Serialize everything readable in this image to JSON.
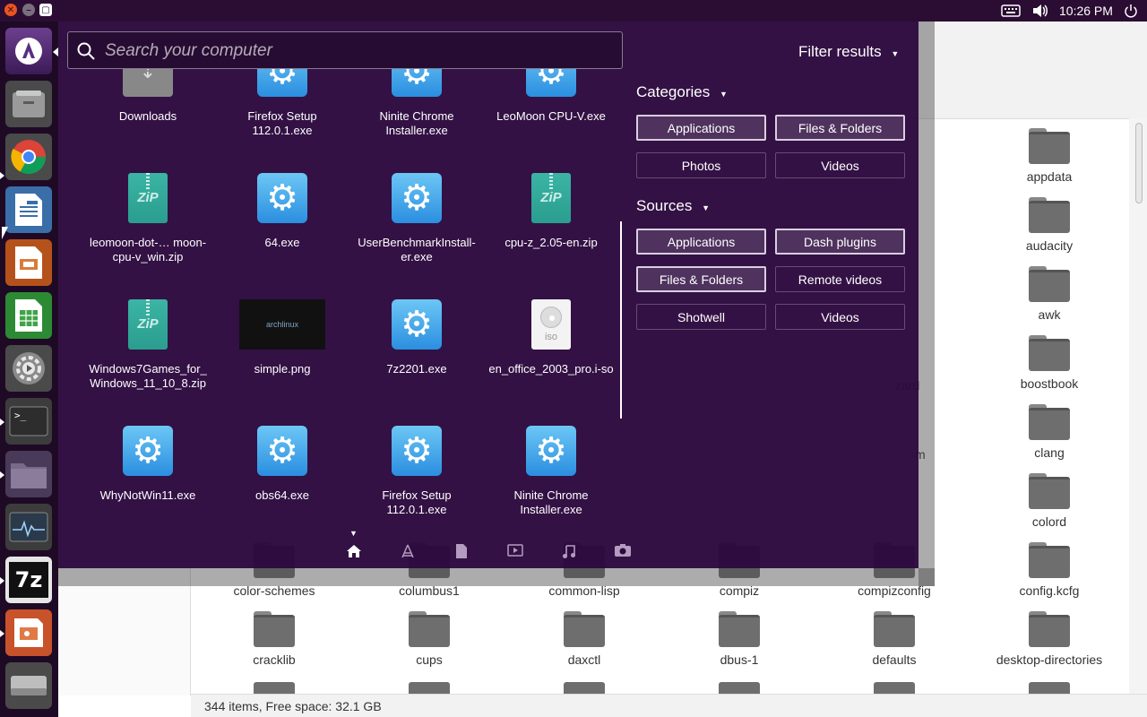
{
  "topbar": {
    "keyboard_icon": "keyboard-icon",
    "volume_icon": "volume-icon",
    "time": "10:26 PM",
    "power_icon": "power-icon"
  },
  "launcher": {
    "items": [
      {
        "name": "dash-home-button",
        "icon": "ubuntu-dash-icon"
      },
      {
        "name": "files-button",
        "icon": "files-icon"
      },
      {
        "name": "chrome-button",
        "icon": "chrome-icon"
      },
      {
        "name": "writer-button",
        "icon": "libreoffice-writer-icon"
      },
      {
        "name": "impress-button",
        "icon": "libreoffice-impress-icon"
      },
      {
        "name": "calc-button",
        "icon": "libreoffice-calc-icon"
      },
      {
        "name": "settings-button",
        "icon": "system-settings-icon"
      },
      {
        "name": "terminal-button",
        "icon": "terminal-icon"
      },
      {
        "name": "folder-button",
        "icon": "folder-icon"
      },
      {
        "name": "system-monitor-button",
        "icon": "system-monitor-icon"
      },
      {
        "name": "7zip-button",
        "icon": "7zip-icon",
        "label": "7z"
      },
      {
        "name": "presentation-button",
        "icon": "presentation-icon"
      },
      {
        "name": "drive-button",
        "icon": "drive-icon"
      }
    ]
  },
  "dash": {
    "search_placeholder": "Search your computer",
    "filter_results_label": "Filter results",
    "categories_label": "Categories",
    "sources_label": "Sources",
    "category_buttons": [
      "Applications",
      "Files & Folders",
      "Photos",
      "Videos"
    ],
    "source_buttons": [
      "Applications",
      "Dash plugins",
      "Files & Folders",
      "Remote videos",
      "Shotwell",
      "Videos"
    ],
    "results": [
      {
        "label": "Downloads",
        "type": "download"
      },
      {
        "label": "Firefox Setup 112.0.1.exe",
        "type": "exe"
      },
      {
        "label": "Ninite Chrome Installer.exe",
        "type": "exe"
      },
      {
        "label": "LeoMoon CPU-V.exe",
        "type": "exe"
      },
      {
        "label": "leomoon-dot-… moon-cpu-v_win.zip",
        "type": "zip"
      },
      {
        "label": "64.exe",
        "type": "exe"
      },
      {
        "label": "UserBenchmarkInstall-er.exe",
        "type": "exe"
      },
      {
        "label": "cpu-z_2.05-en.zip",
        "type": "zip"
      },
      {
        "label": "Windows7Games_for_Windows_11_10_8.zip",
        "type": "zip"
      },
      {
        "label": "simple.png",
        "type": "image"
      },
      {
        "label": "7z2201.exe",
        "type": "exe"
      },
      {
        "label": "en_office_2003_pro.i-so",
        "type": "iso"
      },
      {
        "label": "WhyNotWin11.exe",
        "type": "exe"
      },
      {
        "label": "obs64.exe",
        "type": "exe"
      },
      {
        "label": "Firefox Setup 112.0.1.exe",
        "type": "exe"
      },
      {
        "label": "Ninite Chrome Installer.exe",
        "type": "exe"
      }
    ],
    "image_thumb_text": "archlinux",
    "zip_text": "ZiP",
    "iso_text": "iso",
    "lenses": [
      "home-lens-icon",
      "applications-lens-icon",
      "files-lens-icon",
      "video-lens-icon",
      "music-lens-icon",
      "photos-lens-icon"
    ]
  },
  "file_manager": {
    "status": "344 items, Free space: 32.1 GB",
    "partial_text_1": "zard",
    "partial_text_2": "m",
    "right_column": [
      "appdata",
      "audacity",
      "awk",
      "boostbook",
      "clang",
      "colord",
      "config.kcfg"
    ],
    "bottom_row_1": [
      "color-schemes",
      "columbus1",
      "common-lisp",
      "compiz",
      "compizconfig"
    ],
    "bottom_row_2": [
      "cracklib",
      "cups",
      "daxctl",
      "dbus-1",
      "defaults",
      "desktop-directories"
    ]
  }
}
